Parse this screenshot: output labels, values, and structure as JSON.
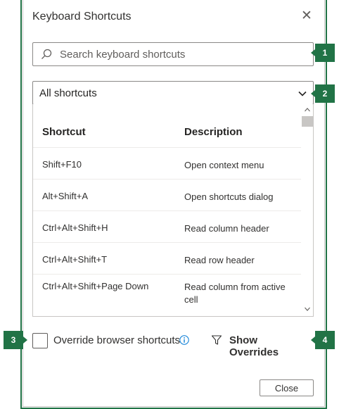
{
  "dialog": {
    "title": "Keyboard Shortcuts",
    "close_glyph": "✕"
  },
  "search": {
    "placeholder": "Search keyboard shortcuts",
    "value": "",
    "icon": "search-icon"
  },
  "filter": {
    "selected": "All shortcuts",
    "icon": "chevron-down-icon"
  },
  "table": {
    "columns": [
      "Shortcut",
      "Description"
    ],
    "rows": [
      {
        "shortcut": "Shift+F10",
        "description": "Open context menu"
      },
      {
        "shortcut": "Alt+Shift+A",
        "description": "Open shortcuts dialog"
      },
      {
        "shortcut": "Ctrl+Alt+Shift+H",
        "description": "Read column header"
      },
      {
        "shortcut": "Ctrl+Alt+Shift+T",
        "description": "Read row header"
      },
      {
        "shortcut": "Ctrl+Alt+Shift+Page Down",
        "description": "Read column from active cell"
      }
    ]
  },
  "options": {
    "override_label": "Override browser shortcuts",
    "override_checked": false,
    "show_overrides_label": "Show Overrides"
  },
  "footer": {
    "close_label": "Close"
  },
  "callouts": [
    "1",
    "2",
    "3",
    "4"
  ],
  "colors": {
    "accent": "#217346",
    "border": "#8a8886",
    "text": "#323130"
  }
}
